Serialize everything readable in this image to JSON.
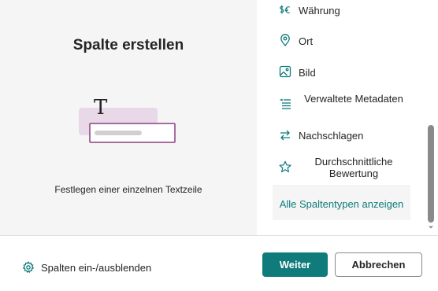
{
  "preview": {
    "title": "Spalte erstellen",
    "description": "Festlegen einer einzelnen Textzeile",
    "illustration_glyph": "T"
  },
  "column_types": [
    {
      "label": "Währung",
      "icon": "currency-icon"
    },
    {
      "label": "Ort",
      "icon": "location-pin-icon"
    },
    {
      "label": "Bild",
      "icon": "image-icon"
    },
    {
      "label": "Verwaltete Metadaten",
      "icon": "managed-metadata-icon"
    },
    {
      "label": "Nachschlagen",
      "icon": "lookup-arrows-icon"
    },
    {
      "label": "Durchschnittliche Bewertung",
      "icon": "star-icon"
    }
  ],
  "all_types_link": "Alle Spaltentypen anzeigen",
  "footer": {
    "toggle_columns_label": "Spalten ein-/ausblenden",
    "next_label": "Weiter",
    "cancel_label": "Abbrechen"
  },
  "colors": {
    "accent": "#0f7b7b",
    "panel_bg": "#f5f5f5",
    "illustration_purple": "#e9d8e8",
    "illustration_border": "#8b3f83"
  }
}
